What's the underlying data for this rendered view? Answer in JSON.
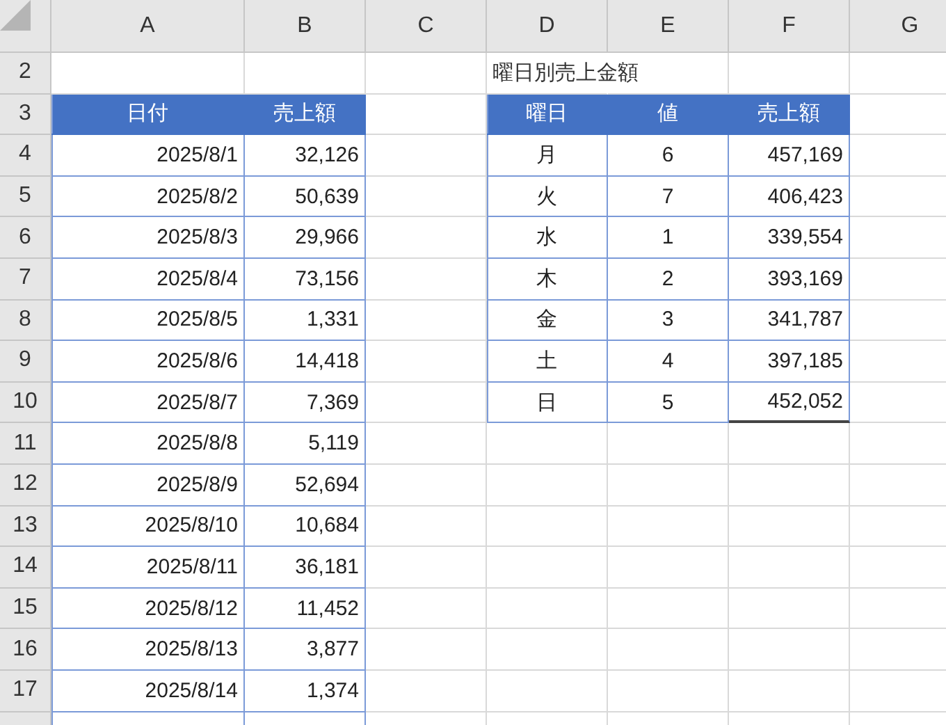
{
  "column_headers": [
    "A",
    "B",
    "C",
    "D",
    "E",
    "F",
    "G"
  ],
  "row_numbers": [
    "2",
    "3",
    "4",
    "5",
    "6",
    "7",
    "8",
    "9",
    "10",
    "11",
    "12",
    "13",
    "14",
    "15",
    "16",
    "17"
  ],
  "summary_title": "曜日別売上金額",
  "sales_table": {
    "columns": [
      "日付",
      "売上額"
    ],
    "rows": [
      {
        "date": "2025/8/1",
        "amount": "32,126"
      },
      {
        "date": "2025/8/2",
        "amount": "50,639"
      },
      {
        "date": "2025/8/3",
        "amount": "29,966"
      },
      {
        "date": "2025/8/4",
        "amount": "73,156"
      },
      {
        "date": "2025/8/5",
        "amount": "1,331"
      },
      {
        "date": "2025/8/6",
        "amount": "14,418"
      },
      {
        "date": "2025/8/7",
        "amount": "7,369"
      },
      {
        "date": "2025/8/8",
        "amount": "5,119"
      },
      {
        "date": "2025/8/9",
        "amount": "52,694"
      },
      {
        "date": "2025/8/10",
        "amount": "10,684"
      },
      {
        "date": "2025/8/11",
        "amount": "36,181"
      },
      {
        "date": "2025/8/12",
        "amount": "11,452"
      },
      {
        "date": "2025/8/13",
        "amount": "3,877"
      },
      {
        "date": "2025/8/14",
        "amount": "1,374"
      }
    ]
  },
  "weekday_table": {
    "columns": [
      "曜日",
      "値",
      "売上額"
    ],
    "rows": [
      {
        "day": "月",
        "value": "6",
        "amount": "457,169"
      },
      {
        "day": "火",
        "value": "7",
        "amount": "406,423"
      },
      {
        "day": "水",
        "value": "1",
        "amount": "339,554"
      },
      {
        "day": "木",
        "value": "2",
        "amount": "393,169"
      },
      {
        "day": "金",
        "value": "3",
        "amount": "341,787"
      },
      {
        "day": "土",
        "value": "4",
        "amount": "397,185"
      },
      {
        "day": "日",
        "value": "5",
        "amount": "452,052"
      }
    ]
  }
}
